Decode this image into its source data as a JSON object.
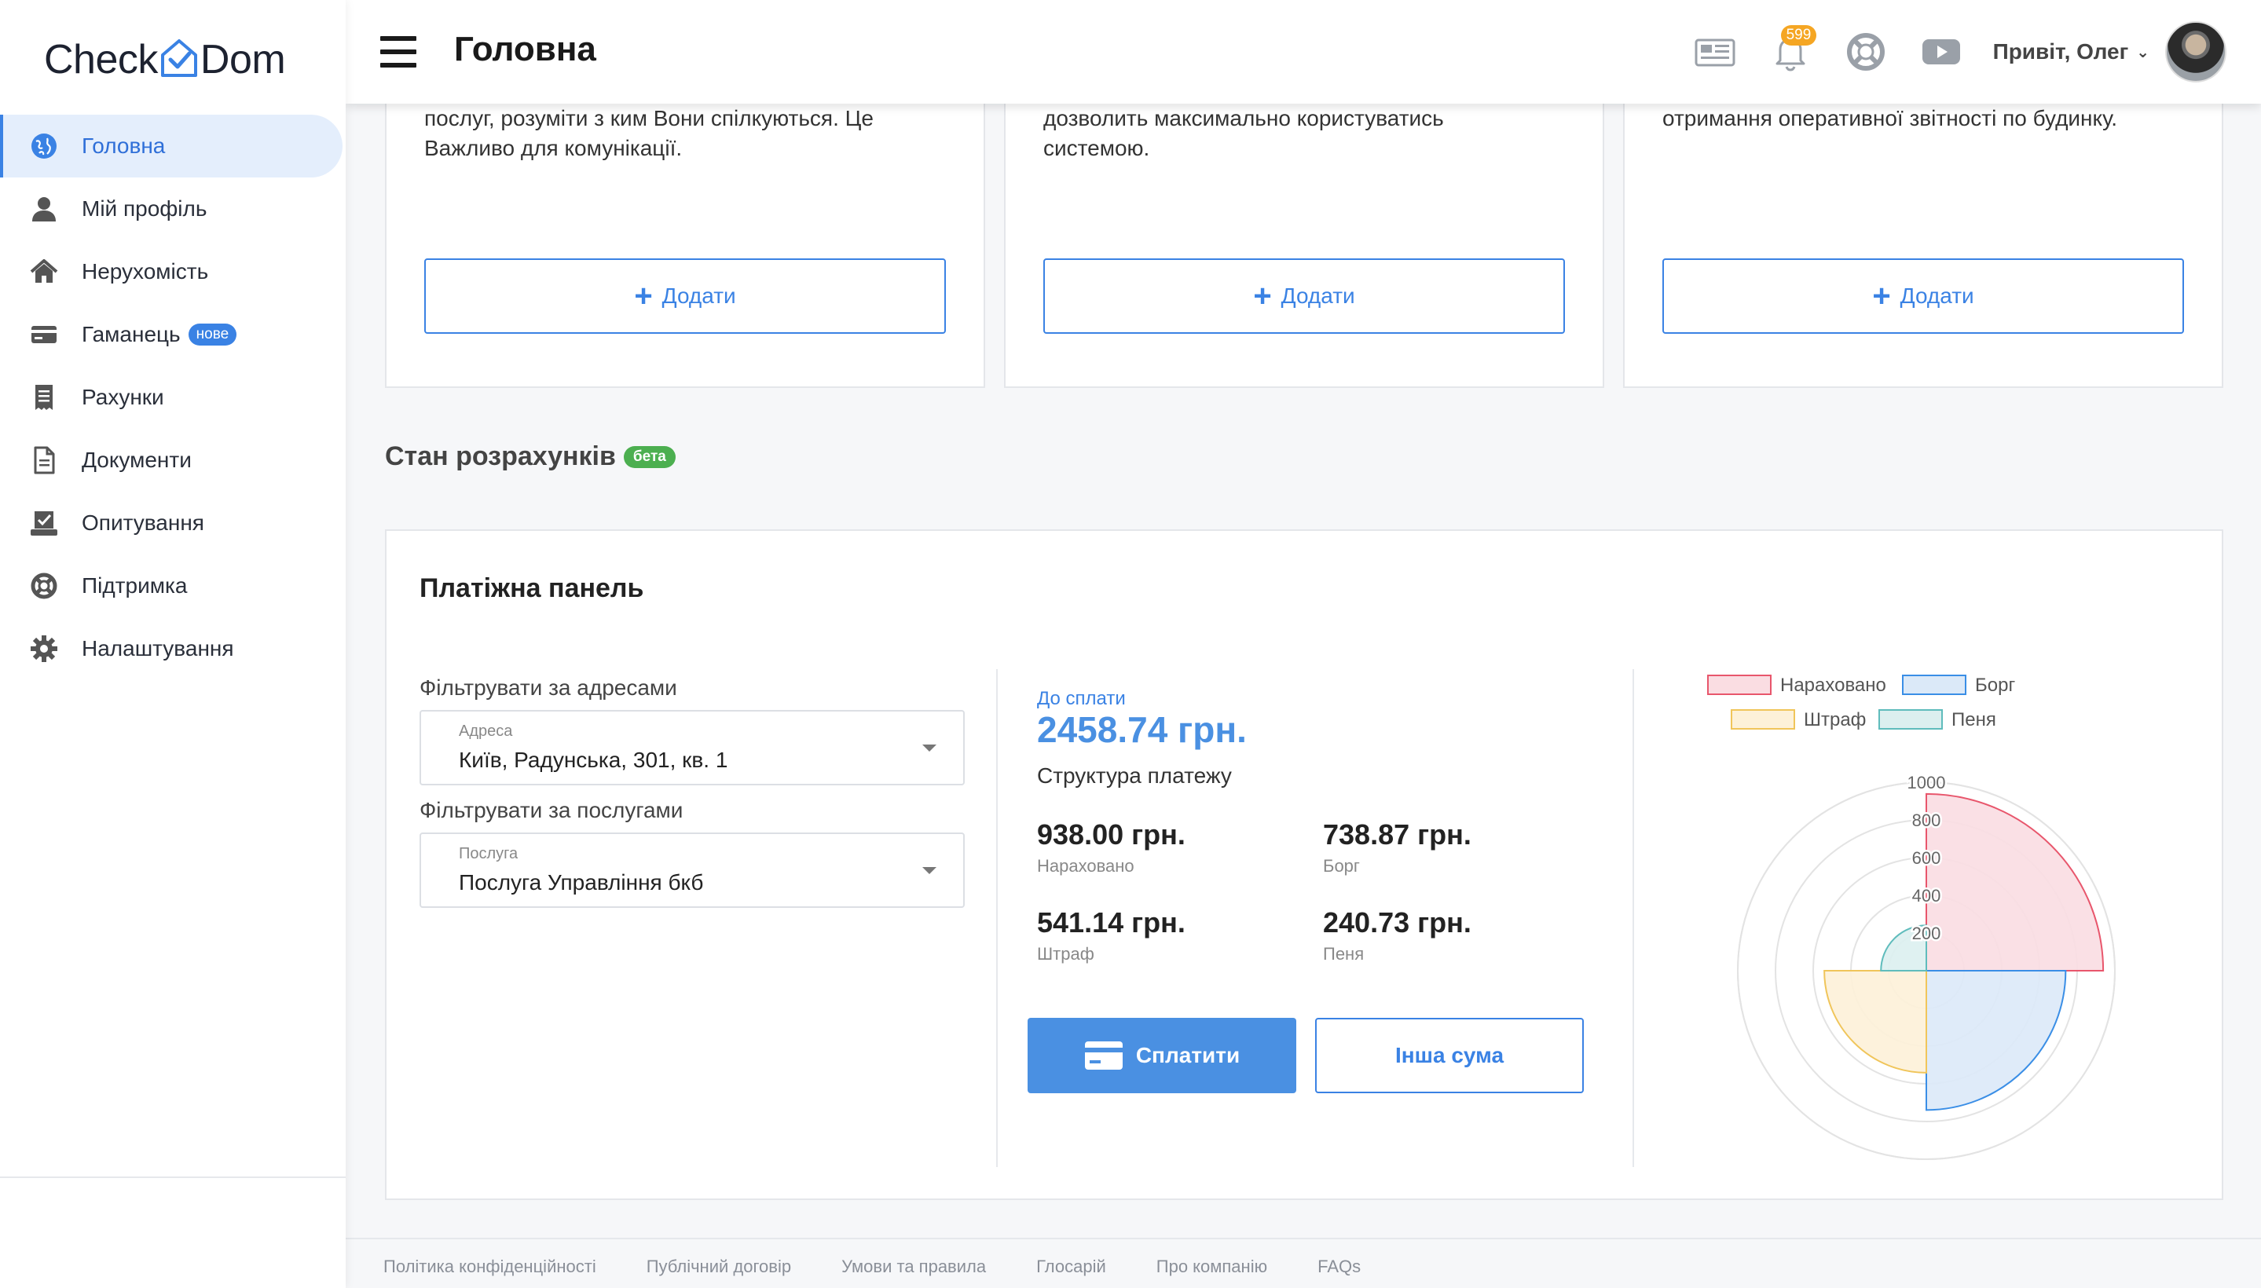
{
  "brand": {
    "logo_left": "Check",
    "logo_right": "Dom"
  },
  "header": {
    "title": "Головна",
    "notifications_count": "599",
    "greeting": "Привіт, Олег",
    "icons": [
      "news-icon",
      "bell-icon",
      "support-icon",
      "video-icon"
    ]
  },
  "sidebar": {
    "items": [
      {
        "label": "Головна",
        "icon": "globe-icon",
        "active": true
      },
      {
        "label": "Мій профіль",
        "icon": "user-icon"
      },
      {
        "label": "Нерухомість",
        "icon": "home-icon"
      },
      {
        "label": "Гаманець",
        "icon": "wallet-icon",
        "badge": "нове"
      },
      {
        "label": "Рахунки",
        "icon": "receipt-icon"
      },
      {
        "label": "Документи",
        "icon": "document-icon"
      },
      {
        "label": "Опитування",
        "icon": "poll-icon"
      },
      {
        "label": "Підтримка",
        "icon": "lifebuoy-icon"
      },
      {
        "label": "Налаштування",
        "icon": "gear-icon"
      }
    ]
  },
  "top_cards": [
    {
      "text": "послуг, розуміти з ким Вони спілкуються. Це\nВажливо для комунікації.",
      "button": "Додати"
    },
    {
      "text": "дозволить максимально користуватись\nсистемою.",
      "button": "Додати"
    },
    {
      "text": "отримання оперативної звітності по будинку.",
      "button": "Додати"
    }
  ],
  "section": {
    "title": "Стан розрахунків",
    "badge": "бета"
  },
  "panel": {
    "title": "Платіжна панель",
    "filter_address_label": "Фільтрувати за адресами",
    "address_field_label": "Адреса",
    "address_value": "Київ, Радунська, 301, кв. 1",
    "filter_service_label": "Фільтрувати за послугами",
    "service_field_label": "Послуга",
    "service_value": "Послуга Управління бкб",
    "due_label": "До сплати",
    "due_amount": "2458.74 грн.",
    "structure_label": "Структура платежу",
    "metrics": [
      {
        "value": "938.00 грн.",
        "label": "Нараховано"
      },
      {
        "value": "738.87 грн.",
        "label": "Борг"
      },
      {
        "value": "541.14 грн.",
        "label": "Штраф"
      },
      {
        "value": "240.73 грн.",
        "label": "Пеня"
      }
    ],
    "pay_button": "Сплатити",
    "other_button": "Інша сума"
  },
  "chart_data": {
    "type": "polarArea",
    "categories": [
      "Нараховано",
      "Борг",
      "Штраф",
      "Пеня"
    ],
    "values": [
      938.0,
      738.87,
      541.14,
      240.73
    ],
    "colors": [
      "#e8566c",
      "#3a8ee6",
      "#f0c55a",
      "#5fbcbc"
    ],
    "fills": [
      "#fadde2",
      "#dbe9f8",
      "#fdf1d8",
      "#dcefef"
    ],
    "rlim": [
      0,
      1000
    ],
    "ticks": [
      200,
      400,
      600,
      800,
      1000
    ],
    "legend": "top"
  },
  "footer": {
    "links": [
      "Політика конфіденційності",
      "Публічний договір",
      "Умови та правила",
      "Глосарій",
      "Про компанію",
      "FAQs"
    ]
  }
}
